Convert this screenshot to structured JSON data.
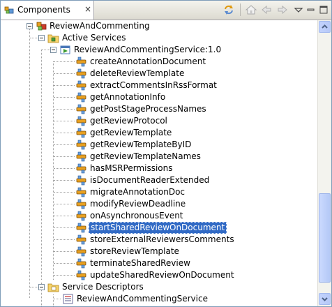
{
  "view": {
    "title": "Components",
    "close_glyph": "×",
    "toolbar_icons": [
      "sync-icon",
      "home-icon",
      "back-icon",
      "forward-icon",
      "view-menu-icon"
    ]
  },
  "tree": {
    "root": {
      "label": "ReviewAndCommenting",
      "icon": "component-icon"
    },
    "active_services": {
      "label": "Active Services",
      "icon": "services-folder-icon"
    },
    "service": {
      "label": "ReviewAndCommentingService:1.0",
      "icon": "service-icon"
    },
    "operations": [
      "createAnnotationDocument",
      "deleteReviewTemplate",
      "extractCommentsInRssFormat",
      "getAnnotationInfo",
      "getPostStageProcessNames",
      "getReviewProtocol",
      "getReviewTemplate",
      "getReviewTemplateByID",
      "getReviewTemplateNames",
      "hasMSRPermissions",
      "isDocumentReaderExtended",
      "migrateAnnotationDoc",
      "modifyReviewDeadline",
      "onAsynchronousEvent",
      "startSharedReviewOnDocument",
      "storeExternalReviewersComments",
      "storeReviewTemplate",
      "terminateSharedReview",
      "updateSharedReviewOnDocument"
    ],
    "selected_operation": "startSharedReviewOnDocument",
    "service_descriptors": {
      "label": "Service Descriptors",
      "icon": "descriptors-folder-icon"
    },
    "descriptor": {
      "label": "ReviewAndCommentingService",
      "icon": "descriptor-icon"
    }
  },
  "colors": {
    "selection": "#316ac5",
    "accent": "#f4a000"
  }
}
